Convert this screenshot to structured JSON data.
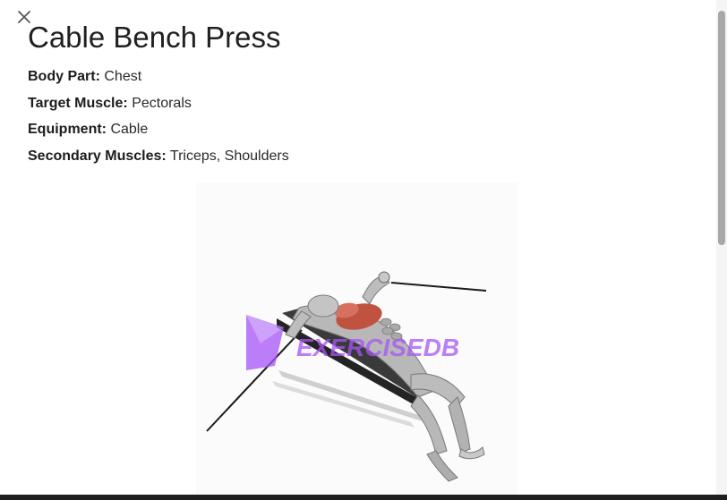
{
  "dialog": {
    "title": "Cable Bench Press",
    "close_icon": "close-icon"
  },
  "details": [
    {
      "label": "Body Part:",
      "value": "Chest"
    },
    {
      "label": "Target Muscle:",
      "value": "Pectorals"
    },
    {
      "label": "Equipment:",
      "value": "Cable"
    },
    {
      "label": "Secondary Muscles:",
      "value": "Triceps, Shoulders"
    }
  ],
  "illustration": {
    "watermark": "EXERCISEDB",
    "colors": {
      "muscle_highlight": "#c0533f",
      "watermark": "#a855f7"
    }
  }
}
